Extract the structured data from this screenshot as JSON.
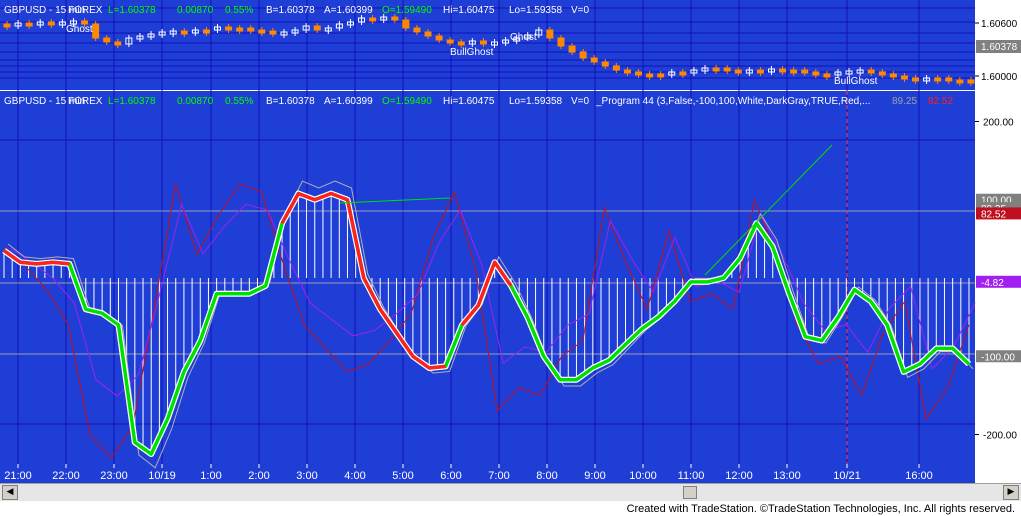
{
  "colors": {
    "background": "#1f3ed6",
    "grid": "#1010b8",
    "text": "#ffffff",
    "green": "#00e000",
    "red": "#ff2020",
    "purple": "#a020f0",
    "darkred": "#c01020",
    "gray": "#b0b0b0",
    "candle_up": "#ffffff",
    "candle_down": "#ff8800",
    "axis_panel": "#ffffff"
  },
  "price_pane": {
    "header_symbol": "GBPUSD - 15 min",
    "header_market": "FOREX",
    "header_quotes": [
      {
        "text": "L=1.60378",
        "color": "#00ff00"
      },
      {
        "text": "0.00870",
        "color": "#00ff00"
      },
      {
        "text": "0.55%",
        "color": "#00ff00"
      },
      {
        "text": "B=1.60378",
        "color": "#ffffff"
      },
      {
        "text": "A=1.60399",
        "color": "#ffffff"
      },
      {
        "text": "O=1.59490",
        "color": "#00ff00"
      },
      {
        "text": "Hi=1.60475",
        "color": "#ffffff"
      },
      {
        "text": "Lo=1.59358",
        "color": "#ffffff"
      },
      {
        "text": "V=0",
        "color": "#ffffff"
      }
    ],
    "labels": [
      "Ghost",
      "BullGhost",
      "Ghost",
      "BullGhost"
    ],
    "axis_ticks": [
      "1.60600",
      "1.60000"
    ],
    "last_price": "1.60378"
  },
  "indicator_pane": {
    "header_symbol": "GBPUSD - 15 min",
    "header_market": "FOREX",
    "header_quotes": [
      {
        "text": "L=1.60378",
        "color": "#00ff00"
      },
      {
        "text": "0.00870",
        "color": "#00ff00"
      },
      {
        "text": "0.55%",
        "color": "#00ff00"
      },
      {
        "text": "B=1.60378",
        "color": "#ffffff"
      },
      {
        "text": "A=1.60399",
        "color": "#ffffff"
      },
      {
        "text": "O=1.59490",
        "color": "#00ff00"
      },
      {
        "text": "Hi=1.60475",
        "color": "#ffffff"
      },
      {
        "text": "Lo=1.59358",
        "color": "#ffffff"
      },
      {
        "text": "V=0",
        "color": "#ffffff"
      }
    ],
    "study": "_Program 44 (3,False,-100,100,White,DarkGray,TRUE,Red,...",
    "study_values": [
      {
        "text": "89.25",
        "color": "#a0a0a0"
      },
      {
        "text": "82.52",
        "color": "#ff2020"
      }
    ],
    "axis_ticks": [
      "200.00",
      "-200.00"
    ],
    "axis_labels": [
      {
        "text": "100.00",
        "bg": "#808080",
        "fg": "#ffffff",
        "value": 100
      },
      {
        "text": "89.25",
        "bg": "#808080",
        "fg": "#ffffff",
        "value": 89.25
      },
      {
        "text": "82.52",
        "bg": "#c01020",
        "fg": "#ffffff",
        "value": 82.52
      },
      {
        "text": "-4.82",
        "bg": "#a020f0",
        "fg": "#ffffff",
        "value": -4.82
      },
      {
        "text": "-100.00",
        "bg": "#808080",
        "fg": "#ffffff",
        "value": -100
      }
    ],
    "y_range": [
      -230,
      230
    ]
  },
  "time_axis": [
    "21:00",
    "22:00",
    "23:00",
    "10/19",
    "1:00",
    "2:00",
    "3:00",
    "4:00",
    "5:00",
    "6:00",
    "7:00",
    "8:00",
    "9:00",
    "10:00",
    "11:00",
    "12:00",
    "13:00",
    "10/21",
    "16:00"
  ],
  "chart_data": {
    "type": "line",
    "title": "",
    "xlabel": "",
    "ylabel": "",
    "ylim": [
      -230,
      230
    ],
    "series": [
      {
        "name": "",
        "values": [
          35,
          20,
          18,
          20,
          18,
          -40,
          -45,
          -60,
          -210,
          -225,
          -180,
          -120,
          -80,
          -20,
          -20,
          -20,
          -10,
          70,
          108,
          100,
          108,
          100,
          0,
          -40,
          -70,
          -100,
          -115,
          -113,
          -60,
          -35,
          20,
          -10,
          -50,
          -100,
          -130,
          -130,
          -115,
          -105,
          -85,
          -65,
          -50,
          -30,
          -5,
          -5,
          0,
          25,
          70,
          40,
          -20,
          -75,
          -80,
          -50,
          -15,
          -30,
          -60,
          -120,
          -110,
          -90,
          -90,
          -110
        ]
      },
      {
        "name": "",
        "values": [
          40,
          15,
          -15,
          -60,
          -200,
          -230,
          -190,
          -40,
          120,
          30,
          80,
          120,
          110,
          20,
          -60,
          -90,
          -120,
          -110,
          -80,
          -45,
          50,
          110,
          10,
          -170,
          -140,
          -150,
          -100,
          -80,
          90,
          20,
          -40,
          60,
          -30,
          -20,
          -40,
          100,
          30,
          -60,
          -110,
          -100,
          -150,
          -70,
          -30,
          -180,
          -140,
          -60
        ]
      }
    ]
  }
}
